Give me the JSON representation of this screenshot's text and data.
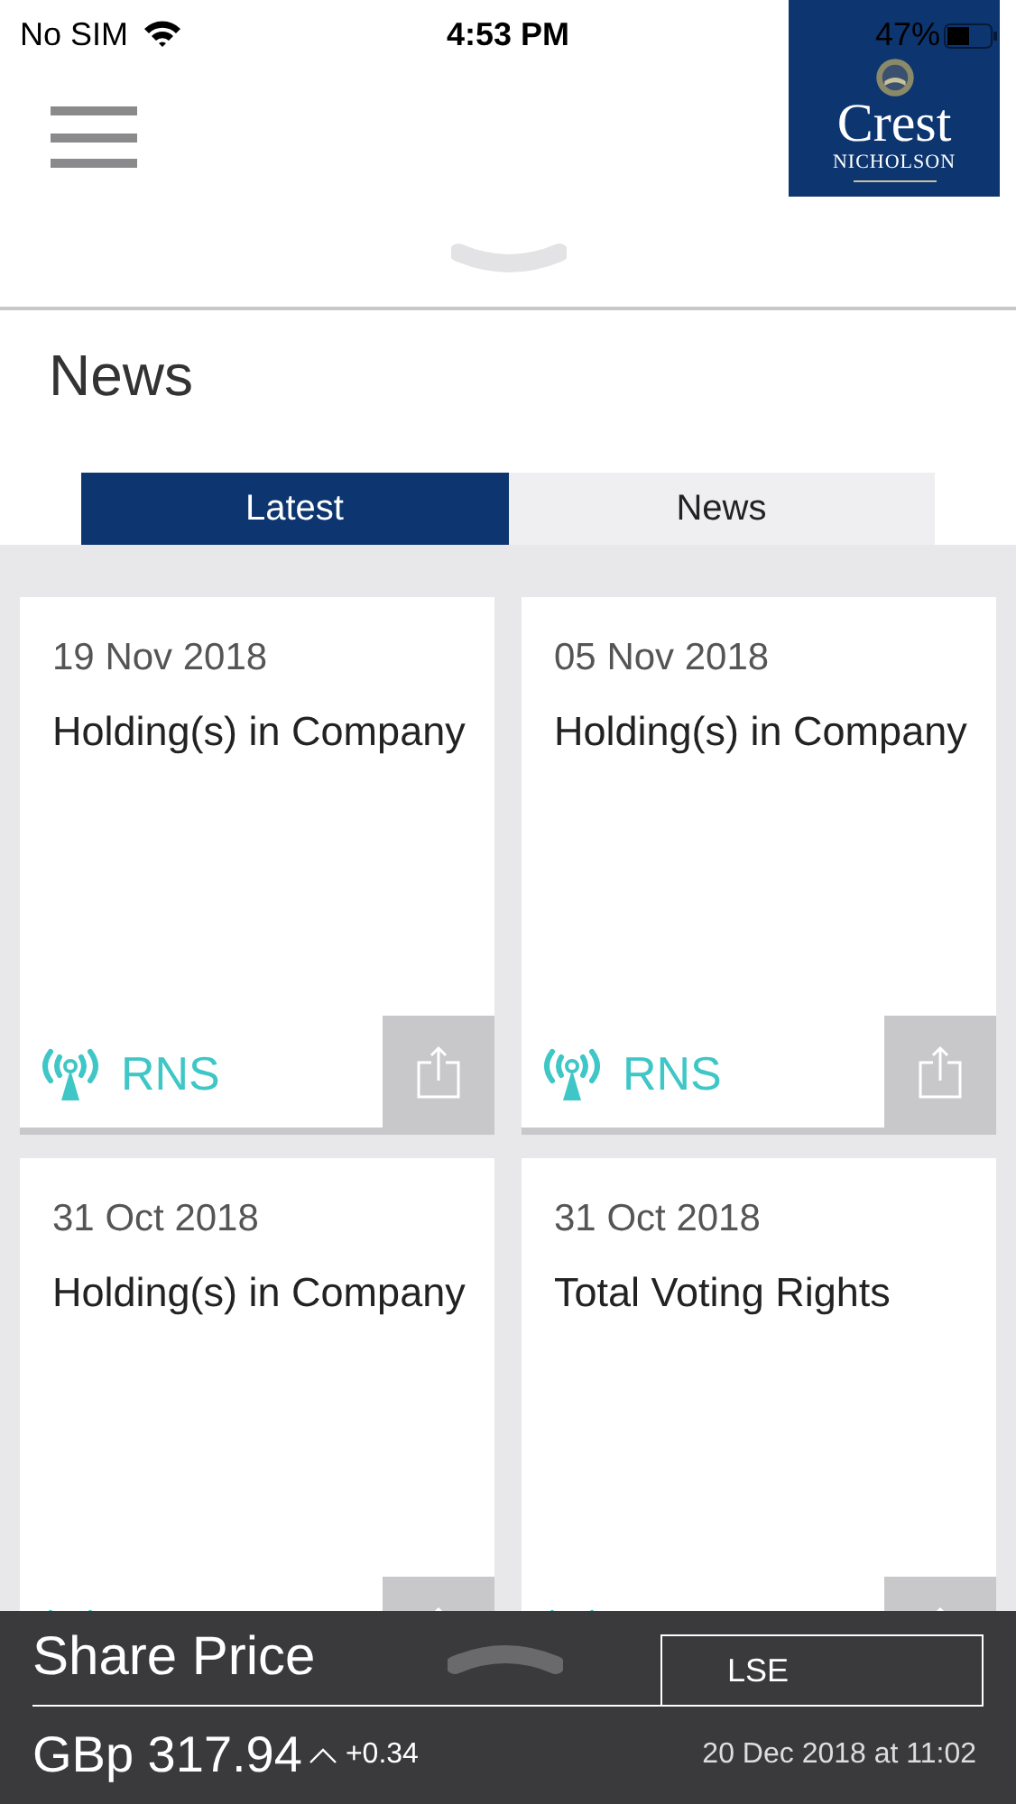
{
  "status_bar": {
    "carrier": "No SIM",
    "time": "4:53 PM",
    "battery": "47%"
  },
  "logo": {
    "name": "Crest",
    "subtitle": "NICHOLSON"
  },
  "page_title": "News",
  "tabs": [
    {
      "label": "Latest",
      "selected": true
    },
    {
      "label": "News",
      "selected": false
    }
  ],
  "cards": [
    {
      "date": "19 Nov 2018",
      "title": "Holding(s) in Company",
      "source": "RNS"
    },
    {
      "date": "05 Nov 2018",
      "title": "Holding(s) in Company",
      "source": "RNS"
    },
    {
      "date": "31 Oct 2018",
      "title": "Holding(s) in Company"
    },
    {
      "date": "31 Oct 2018",
      "title": "Total Voting Rights"
    }
  ],
  "share_price": {
    "title": "Share Price",
    "exchange": "LSE",
    "price": "GBp 317.94",
    "change": "+0.34",
    "timestamp": "20 Dec 2018 at 11:02"
  }
}
